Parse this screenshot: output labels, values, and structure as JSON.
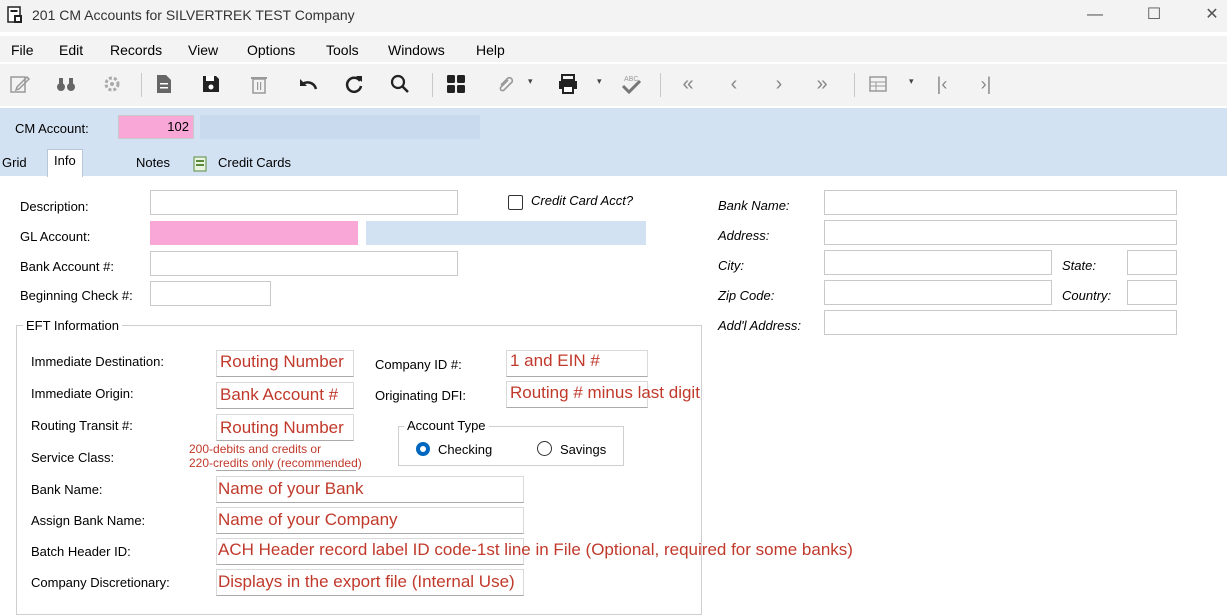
{
  "window": {
    "title": "201 CM Accounts for SILVERTREK TEST Company",
    "controls": {
      "minimize": "—",
      "maximize": "☐",
      "close": "✕"
    }
  },
  "menu": [
    "File",
    "Edit",
    "Records",
    "View",
    "Options",
    "Tools",
    "Windows",
    "Help"
  ],
  "toolbar": {
    "icons": [
      "edit-icon",
      "binoculars-icon",
      "settings-icon",
      "new-doc-icon",
      "save-icon",
      "delete-icon",
      "undo-icon",
      "refresh-icon",
      "search-icon",
      "calculator-icon",
      "attach-icon",
      "print-icon",
      "spellcheck-icon",
      "first-icon",
      "prev-icon",
      "next-icon",
      "last-icon",
      "grid-icon",
      "go-first-icon",
      "go-last-icon"
    ]
  },
  "account": {
    "label": "CM Account:",
    "value": "102"
  },
  "tabs": [
    "Grid",
    "Info",
    "Notes",
    "Credit Cards"
  ],
  "form": {
    "description": {
      "label": "Description:",
      "value": ""
    },
    "credit_card_acct": {
      "label": "Credit Card Acct?",
      "checked": false
    },
    "gl_account": {
      "label": "GL Account:",
      "value": ""
    },
    "bank_account": {
      "label": "Bank Account #:",
      "value": ""
    },
    "beginning_check": {
      "label": "Beginning Check #:",
      "value": ""
    },
    "bank_name": {
      "label": "Bank Name:",
      "value": ""
    },
    "address": {
      "label": "Address:",
      "value": ""
    },
    "city": {
      "label": "City:",
      "value": ""
    },
    "state": {
      "label": "State:",
      "value": ""
    },
    "zip": {
      "label": "Zip Code:",
      "value": ""
    },
    "country": {
      "label": "Country:",
      "value": ""
    },
    "addl_address": {
      "label": "Add'l Address:",
      "value": ""
    }
  },
  "eft": {
    "legend": "EFT Information",
    "immediate_destination": {
      "label": "Immediate Destination:",
      "value": "Routing Number"
    },
    "immediate_origin": {
      "label": "Immediate Origin:",
      "value": "Bank Account #"
    },
    "routing_transit": {
      "label": "Routing Transit #:",
      "value": "Routing Number"
    },
    "service_class": {
      "label": "Service Class:",
      "note_line1": "200-debits and credits or",
      "note_line2": "220-credits only (recommended)"
    },
    "company_id": {
      "label": "Company ID #:",
      "value": "1 and EIN #"
    },
    "originating_dfi": {
      "label": "Originating DFI:",
      "value": "Routing # minus last digit"
    },
    "account_type": {
      "legend": "Account Type",
      "checking": "Checking",
      "savings": "Savings",
      "selected": "Checking"
    },
    "bank_name": {
      "label": "Bank Name:",
      "value": "Name of your Bank"
    },
    "assign_bank_name": {
      "label": "Assign Bank Name:",
      "value": "Name of your Company"
    },
    "batch_header_id": {
      "label": "Batch Header ID:",
      "value": "ACH Header record label ID code-1st line in File (Optional, required for some banks)"
    },
    "company_discretionary": {
      "label": "Company Discretionary:",
      "value": "Displays in the export file (Internal Use)"
    }
  }
}
